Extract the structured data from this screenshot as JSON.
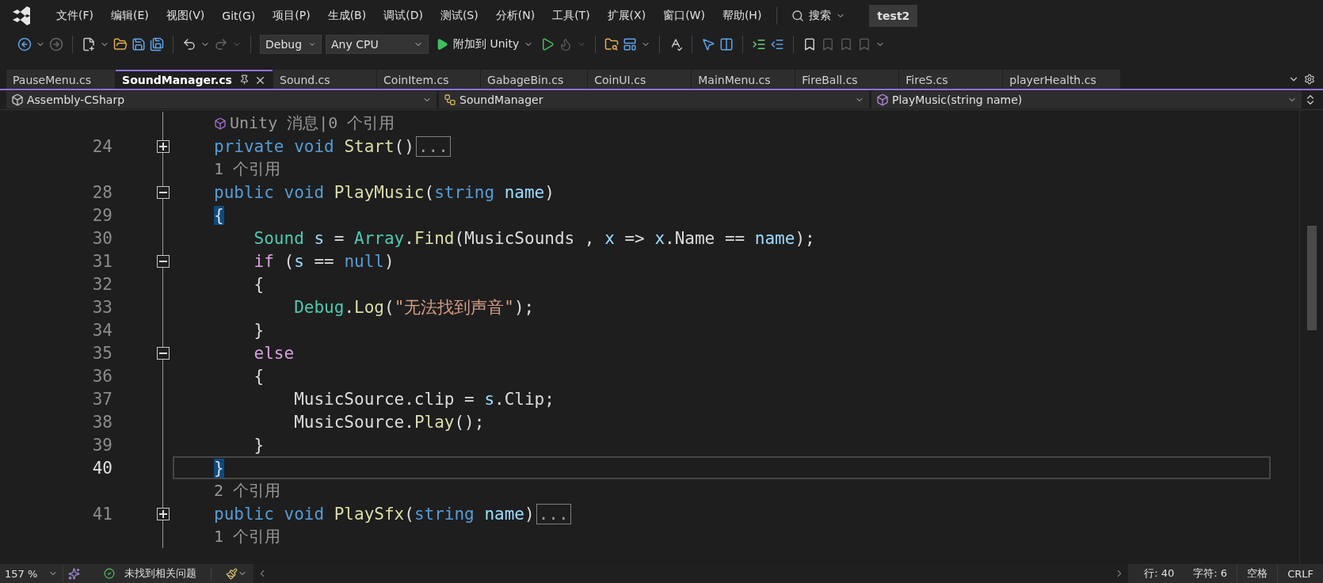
{
  "menu": [
    "文件(F)",
    "编辑(E)",
    "视图(V)",
    "Git(G)",
    "项目(P)",
    "生成(B)",
    "调试(D)",
    "测试(S)",
    "分析(N)",
    "工具(T)",
    "扩展(X)",
    "窗口(W)",
    "帮助(H)"
  ],
  "search": {
    "label": "搜索"
  },
  "solution": "test2",
  "toolbar": {
    "configuration": "Debug",
    "platform": "Any CPU",
    "attach": "附加到 Unity"
  },
  "tabs": [
    {
      "label": "PauseMenu.cs",
      "selected": false
    },
    {
      "label": "SoundManager.cs",
      "selected": true
    },
    {
      "label": "Sound.cs",
      "selected": false
    },
    {
      "label": "CoinItem.cs",
      "selected": false
    },
    {
      "label": "GabageBin.cs",
      "selected": false
    },
    {
      "label": "CoinUI.cs",
      "selected": false
    },
    {
      "label": "MainMenu.cs",
      "selected": false
    },
    {
      "label": "FireBall.cs",
      "selected": false
    },
    {
      "label": "FireS.cs",
      "selected": false
    },
    {
      "label": "playerHealth.cs",
      "selected": false
    }
  ],
  "navigation": {
    "project": "Assembly-CSharp",
    "type": "SoundManager",
    "member": "PlayMusic(string name)"
  },
  "lines": [
    {
      "kind": "lens",
      "text": "Unity 消息|0 个引用",
      "unity_icon": true
    },
    {
      "kind": "code",
      "number": "24",
      "foldable": true,
      "collapsed": true,
      "current": false,
      "tokens": [
        {
          "text": "private void ",
          "kind": "keyword"
        },
        {
          "text": "Start",
          "kind": "method"
        },
        {
          "text": "()",
          "kind": "plain"
        },
        {
          "text": "...",
          "kind": "collapsed"
        }
      ]
    },
    {
      "kind": "lens",
      "text": "1 个引用",
      "unity_icon": false
    },
    {
      "kind": "code",
      "number": "28",
      "foldable": true,
      "collapsed": false,
      "current": false,
      "tokens": [
        {
          "text": "public void ",
          "kind": "keyword"
        },
        {
          "text": "PlayMusic",
          "kind": "method"
        },
        {
          "text": "(",
          "kind": "plain"
        },
        {
          "text": "string ",
          "kind": "keyword"
        },
        {
          "text": "name",
          "kind": "variable"
        },
        {
          "text": ")",
          "kind": "plain"
        }
      ]
    },
    {
      "kind": "code",
      "number": "29",
      "foldable": false,
      "current": false,
      "tokens": [
        {
          "text": "{",
          "kind": "brace_match"
        }
      ]
    },
    {
      "kind": "code",
      "number": "30",
      "foldable": false,
      "current": false,
      "tokens": [
        {
          "text": "    Sound ",
          "kind": "type"
        },
        {
          "text": "s",
          "kind": "variable"
        },
        {
          "text": " = ",
          "kind": "plain"
        },
        {
          "text": "Array",
          "kind": "type"
        },
        {
          "text": ".",
          "kind": "plain"
        },
        {
          "text": "Find",
          "kind": "method"
        },
        {
          "text": "(MusicSounds , ",
          "kind": "plain"
        },
        {
          "text": "x",
          "kind": "variable"
        },
        {
          "text": " => ",
          "kind": "plain"
        },
        {
          "text": "x",
          "kind": "variable"
        },
        {
          "text": ".Name == ",
          "kind": "plain"
        },
        {
          "text": "name",
          "kind": "variable"
        },
        {
          "text": ");",
          "kind": "plain"
        }
      ]
    },
    {
      "kind": "code",
      "number": "31",
      "foldable": true,
      "collapsed": false,
      "current": false,
      "tokens": [
        {
          "text": "    if",
          "kind": "control"
        },
        {
          "text": " (",
          "kind": "plain"
        },
        {
          "text": "s",
          "kind": "variable"
        },
        {
          "text": " == ",
          "kind": "plain"
        },
        {
          "text": "null",
          "kind": "keyword"
        },
        {
          "text": ")",
          "kind": "plain"
        }
      ]
    },
    {
      "kind": "code",
      "number": "32",
      "foldable": false,
      "current": false,
      "tokens": [
        {
          "text": "    {",
          "kind": "plain"
        }
      ]
    },
    {
      "kind": "code",
      "number": "33",
      "foldable": false,
      "current": false,
      "tokens": [
        {
          "text": "        Debug",
          "kind": "type"
        },
        {
          "text": ".",
          "kind": "plain"
        },
        {
          "text": "Log",
          "kind": "method"
        },
        {
          "text": "(",
          "kind": "plain"
        },
        {
          "text": "\"无法找到声音\"",
          "kind": "string"
        },
        {
          "text": ");",
          "kind": "plain"
        }
      ]
    },
    {
      "kind": "code",
      "number": "34",
      "foldable": false,
      "current": false,
      "tokens": [
        {
          "text": "    }",
          "kind": "plain"
        }
      ]
    },
    {
      "kind": "code",
      "number": "35",
      "foldable": true,
      "collapsed": false,
      "current": false,
      "tokens": [
        {
          "text": "    else",
          "kind": "control"
        }
      ]
    },
    {
      "kind": "code",
      "number": "36",
      "foldable": false,
      "current": false,
      "tokens": [
        {
          "text": "    {",
          "kind": "plain"
        }
      ]
    },
    {
      "kind": "code",
      "number": "37",
      "foldable": false,
      "current": false,
      "tokens": [
        {
          "text": "        MusicSource.clip = ",
          "kind": "plain"
        },
        {
          "text": "s",
          "kind": "variable"
        },
        {
          "text": ".Clip;",
          "kind": "plain"
        }
      ]
    },
    {
      "kind": "code",
      "number": "38",
      "foldable": false,
      "current": false,
      "tokens": [
        {
          "text": "        MusicSource.",
          "kind": "plain"
        },
        {
          "text": "Play",
          "kind": "method"
        },
        {
          "text": "();",
          "kind": "plain"
        }
      ]
    },
    {
      "kind": "code",
      "number": "39",
      "foldable": false,
      "current": false,
      "tokens": [
        {
          "text": "    }",
          "kind": "plain"
        }
      ]
    },
    {
      "kind": "code",
      "number": "40",
      "foldable": false,
      "current": true,
      "tokens": [
        {
          "text": "}",
          "kind": "brace_match"
        }
      ]
    },
    {
      "kind": "lens",
      "text": "2 个引用",
      "unity_icon": false
    },
    {
      "kind": "code",
      "number": "41",
      "foldable": true,
      "collapsed": true,
      "current": false,
      "tokens": [
        {
          "text": "public void ",
          "kind": "keyword"
        },
        {
          "text": "PlaySfx",
          "kind": "method"
        },
        {
          "text": "(",
          "kind": "plain"
        },
        {
          "text": "string ",
          "kind": "keyword"
        },
        {
          "text": "name",
          "kind": "variable"
        },
        {
          "text": ")",
          "kind": "plain"
        },
        {
          "text": "...",
          "kind": "collapsed"
        }
      ]
    },
    {
      "kind": "lens",
      "text": "1 个引用",
      "unity_icon": false
    }
  ],
  "status_bar": {
    "zoom": "157 %",
    "issues": "未找到相关问题",
    "line": "行: 40",
    "column": "字符: 6",
    "whitespace": "空格",
    "line_ending": "CRLF"
  }
}
